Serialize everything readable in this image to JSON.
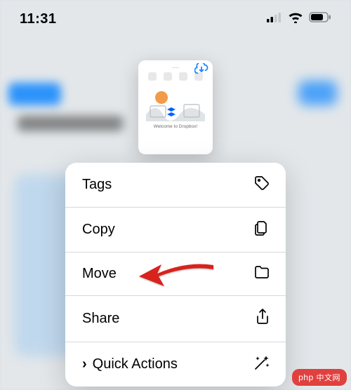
{
  "status": {
    "time": "11:31"
  },
  "preview": {
    "caption": "Welcome to Dropbox!",
    "cloud_icon": "cloud-download-icon"
  },
  "menu": {
    "items": [
      {
        "label": "Tags",
        "icon": "tag-icon"
      },
      {
        "label": "Copy",
        "icon": "copy-icon"
      },
      {
        "label": "Move",
        "icon": "folder-icon"
      },
      {
        "label": "Share",
        "icon": "share-icon"
      },
      {
        "label": "Quick Actions",
        "icon": "wand-icon",
        "has_chevron": true
      }
    ]
  },
  "watermark": {
    "brand": "php",
    "text_cn": "中文网"
  },
  "annotation": {
    "arrow_points_to": "Move"
  }
}
